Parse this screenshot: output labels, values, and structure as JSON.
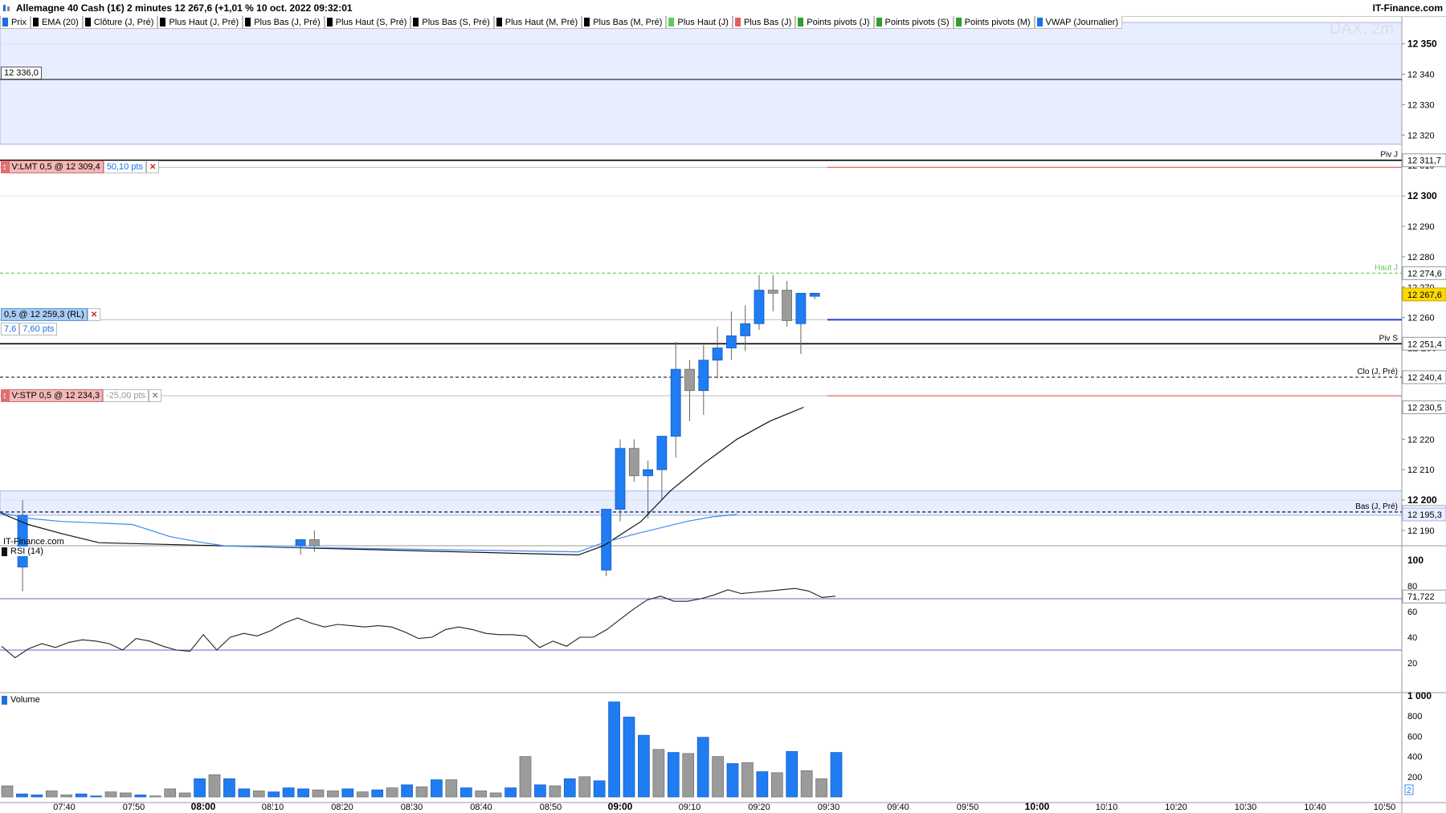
{
  "header": {
    "title": "Allemagne 40 Cash (1€) 2 minutes 12 267,6 (+1,01 % 10 oct. 2022 09:32:01",
    "brand": "IT-Finance.com"
  },
  "legend": [
    {
      "label": "Prix",
      "color": "#1f6fe0"
    },
    {
      "label": "EMA (20)",
      "color": "#000000"
    },
    {
      "label": "Clôture (J, Pré)",
      "color": "#000000"
    },
    {
      "label": "Plus Haut (J, Pré)",
      "color": "#000000"
    },
    {
      "label": "Plus Bas (J, Pré)",
      "color": "#000000"
    },
    {
      "label": "Plus Haut (S, Pré)",
      "color": "#000000"
    },
    {
      "label": "Plus Bas (S, Pré)",
      "color": "#000000"
    },
    {
      "label": "Plus Haut (M, Pré)",
      "color": "#000000"
    },
    {
      "label": "Plus Bas (M, Pré)",
      "color": "#000000"
    },
    {
      "label": "Plus Haut (J)",
      "color": "#5ecb5e"
    },
    {
      "label": "Plus Bas (J)",
      "color": "#e06060"
    },
    {
      "label": "Points pivots (J)",
      "color": "#2e9e2e"
    },
    {
      "label": "Points pivots (S)",
      "color": "#2e9e2e"
    },
    {
      "label": "Points pivots (M)",
      "color": "#2e9e2e"
    },
    {
      "label": "VWAP (Journalier)",
      "color": "#1f6fe0"
    }
  ],
  "watermark": "DAX, 2m",
  "source_label": "IT-Finance.com",
  "orders": {
    "limit": {
      "label": "V:LMT  0,5 @ 12 309,4",
      "distance": "50,10 pts",
      "price": 12309.4
    },
    "position": {
      "label": "0,5 @ 12 259,3 (RL)",
      "pnl": "7,6",
      "pnl_pts": "7,60 pts",
      "price": 12259.3
    },
    "stop": {
      "label": "V:STP  0,5 @ 12 234,3",
      "distance": "-25,00 pts",
      "price": 12234.3
    },
    "cursor_level": "12 336,0"
  },
  "levels": [
    {
      "name": "Piv J",
      "value": 12311.7,
      "label": "12 311,7",
      "color": "#000000",
      "style": "solid"
    },
    {
      "name": "Haut J",
      "value": 12274.6,
      "label": "12 274,6",
      "color": "#5ecb5e",
      "style": "dashed"
    },
    {
      "name": "Piv S",
      "value": 12251.4,
      "label": "12 251,4",
      "color": "#000000",
      "style": "solid"
    },
    {
      "name": "Clo (J, Pré)",
      "value": 12240.4,
      "label": "12 240,4",
      "color": "#000000",
      "style": "dashed"
    },
    {
      "name": "Bas (J, Pré)",
      "value": 12196.1,
      "label": "12 196,1",
      "color": "#000000",
      "style": "dashed"
    }
  ],
  "price_tags": {
    "last": {
      "value": 12267.6,
      "label": "12 267,6",
      "color": "#ffd800"
    },
    "ema": {
      "value": 12230.5,
      "label": "12 230,5"
    },
    "vwap": {
      "value": 12195.3,
      "label": "12 195,3"
    }
  },
  "price_panel": {
    "type": "candlestick",
    "ylim": [
      12185,
      12357
    ],
    "ticks": [
      {
        "v": 12350,
        "label": "12 350",
        "bold": true
      },
      {
        "v": 12340,
        "label": "12 340",
        "bold": false
      },
      {
        "v": 12330,
        "label": "12 330",
        "bold": false
      },
      {
        "v": 12320,
        "label": "12 320",
        "bold": false
      },
      {
        "v": 12310,
        "label": "12 310",
        "bold": false
      },
      {
        "v": 12300,
        "label": "12 300",
        "bold": true
      },
      {
        "v": 12290,
        "label": "12 290",
        "bold": false
      },
      {
        "v": 12280,
        "label": "12 280",
        "bold": false
      },
      {
        "v": 12270,
        "label": "12 270",
        "bold": false
      },
      {
        "v": 12260,
        "label": "12 260",
        "bold": false
      },
      {
        "v": 12250,
        "label": "12 250",
        "bold": true
      },
      {
        "v": 12240,
        "label": "12 240",
        "bold": false
      },
      {
        "v": 12230,
        "label": "12 230",
        "bold": false
      },
      {
        "v": 12220,
        "label": "12 220",
        "bold": false
      },
      {
        "v": 12210,
        "label": "12 210",
        "bold": false
      },
      {
        "v": 12200,
        "label": "12 200",
        "bold": true
      },
      {
        "v": 12190,
        "label": "12 190",
        "bold": false
      }
    ],
    "zones": [
      {
        "from": 12317,
        "to": 12357
      },
      {
        "from": 12195,
        "to": 12203
      }
    ]
  },
  "chart_data": {
    "type": "candlestick",
    "time_labels": [
      {
        "t": "07:40",
        "bold": false
      },
      {
        "t": "07:50",
        "bold": false
      },
      {
        "t": "08:00",
        "bold": true
      },
      {
        "t": "08:10",
        "bold": false
      },
      {
        "t": "08:20",
        "bold": false
      },
      {
        "t": "08:30",
        "bold": false
      },
      {
        "t": "08:40",
        "bold": false
      },
      {
        "t": "08:50",
        "bold": false
      },
      {
        "t": "09:00",
        "bold": true
      },
      {
        "t": "09:10",
        "bold": false
      },
      {
        "t": "09:20",
        "bold": false
      },
      {
        "t": "09:30",
        "bold": false
      },
      {
        "t": "09:40",
        "bold": false
      },
      {
        "t": "09:50",
        "bold": false
      },
      {
        "t": "10:00",
        "bold": true
      },
      {
        "t": "10:10",
        "bold": false
      },
      {
        "t": "10:20",
        "bold": false
      },
      {
        "t": "10:30",
        "bold": false
      },
      {
        "t": "10:40",
        "bold": false
      },
      {
        "t": "10:50",
        "bold": false
      }
    ],
    "candles": [
      {
        "t": "07:34",
        "o": 12178,
        "h": 12200,
        "l": 12170,
        "c": 12195
      },
      {
        "t": "08:14",
        "o": 12185,
        "h": 12187,
        "l": 12182,
        "c": 12187
      },
      {
        "t": "08:16",
        "o": 12187,
        "h": 12190,
        "l": 12183,
        "c": 12185
      },
      {
        "t": "08:58",
        "o": 12177,
        "h": 12197,
        "l": 12175,
        "c": 12197
      },
      {
        "t": "09:00",
        "o": 12197,
        "h": 12220,
        "l": 12193,
        "c": 12217
      },
      {
        "t": "09:02",
        "o": 12217,
        "h": 12220,
        "l": 12206,
        "c": 12208
      },
      {
        "t": "09:04",
        "o": 12208,
        "h": 12213,
        "l": 12194,
        "c": 12210
      },
      {
        "t": "09:06",
        "o": 12210,
        "h": 12215,
        "l": 12200,
        "c": 12221
      },
      {
        "t": "09:08",
        "o": 12221,
        "h": 12252,
        "l": 12214,
        "c": 12243
      },
      {
        "t": "09:10",
        "o": 12243,
        "h": 12246,
        "l": 12226,
        "c": 12236
      },
      {
        "t": "09:12",
        "o": 12236,
        "h": 12251,
        "l": 12228,
        "c": 12246
      },
      {
        "t": "09:14",
        "o": 12246,
        "h": 12257,
        "l": 12240,
        "c": 12250
      },
      {
        "t": "09:16",
        "o": 12250,
        "h": 12262,
        "l": 12246,
        "c": 12254
      },
      {
        "t": "09:18",
        "o": 12254,
        "h": 12264,
        "l": 12249,
        "c": 12258
      },
      {
        "t": "09:20",
        "o": 12258,
        "h": 12274,
        "l": 12256,
        "c": 12269
      },
      {
        "t": "09:22",
        "o": 12269,
        "h": 12274,
        "l": 12262,
        "c": 12268
      },
      {
        "t": "09:24",
        "o": 12269,
        "h": 12272,
        "l": 12257,
        "c": 12259
      },
      {
        "t": "09:26",
        "o": 12258,
        "h": 12268,
        "l": 12248,
        "c": 12268
      },
      {
        "t": "09:28",
        "o": 12267,
        "h": 12268,
        "l": 12266,
        "c": 12268
      }
    ],
    "ema": [
      [
        7.51,
        12196
      ],
      [
        7.58,
        12192
      ],
      [
        7.66,
        12189
      ],
      [
        7.75,
        12186
      ],
      [
        8.9,
        12182
      ],
      [
        8.96,
        12185
      ],
      [
        9.05,
        12193
      ],
      [
        9.12,
        12203
      ],
      [
        9.2,
        12212
      ],
      [
        9.28,
        12220
      ],
      [
        9.36,
        12226
      ],
      [
        9.44,
        12230.5
      ]
    ],
    "vwap": [
      [
        7.51,
        12196
      ],
      [
        7.58,
        12194
      ],
      [
        7.66,
        12193
      ],
      [
        7.83,
        12192
      ],
      [
        7.92,
        12188
      ],
      [
        8.0,
        12186
      ],
      [
        8.05,
        12185
      ],
      [
        8.22,
        12184.5
      ],
      [
        8.9,
        12183
      ],
      [
        8.96,
        12186
      ],
      [
        9.04,
        12189
      ],
      [
        9.1,
        12191
      ],
      [
        9.16,
        12193
      ],
      [
        9.22,
        12194.5
      ],
      [
        9.28,
        12195.3
      ]
    ],
    "rsi": {
      "label": "RSI (14)",
      "value_label": "71,722",
      "ylim": [
        0,
        110
      ],
      "ticks": [
        {
          "v": 100,
          "label": "100",
          "bold": true
        },
        {
          "v": 80,
          "label": "80",
          "bold": false
        },
        {
          "v": 60,
          "label": "60",
          "bold": false
        },
        {
          "v": 40,
          "label": "40",
          "bold": false
        },
        {
          "v": 20,
          "label": "20",
          "bold": false
        }
      ],
      "bands": [
        70,
        30
      ],
      "values": [
        33,
        24,
        31,
        35,
        32,
        36,
        38,
        37,
        35,
        30,
        39,
        37,
        33,
        30,
        29,
        42,
        30,
        40,
        43,
        41,
        45,
        51,
        55,
        51,
        48,
        50,
        49,
        48,
        49,
        48,
        44,
        39,
        40,
        46,
        48,
        46,
        43,
        42,
        42,
        41,
        32,
        37,
        33,
        40,
        40,
        46,
        54,
        62,
        69,
        72,
        68,
        68,
        70,
        73,
        77,
        74,
        75,
        76,
        77,
        78,
        76,
        71,
        72
      ]
    },
    "volume": {
      "label": "Volume",
      "ylim": [
        0,
        1050
      ],
      "ticks": [
        {
          "v": 1000,
          "label": "1 000",
          "bold": true
        },
        {
          "v": 800,
          "label": "800",
          "bold": false
        },
        {
          "v": 600,
          "label": "600",
          "bold": false
        },
        {
          "v": 400,
          "label": "400",
          "bold": false
        },
        {
          "v": 200,
          "label": "200",
          "bold": false
        }
      ],
      "current_label": "2",
      "bars": [
        {
          "v": 110,
          "d": "down"
        },
        {
          "v": 30,
          "d": "up"
        },
        {
          "v": 20,
          "d": "up"
        },
        {
          "v": 60,
          "d": "down"
        },
        {
          "v": 20,
          "d": "down"
        },
        {
          "v": 30,
          "d": "up"
        },
        {
          "v": 10,
          "d": "up"
        },
        {
          "v": 50,
          "d": "down"
        },
        {
          "v": 40,
          "d": "down"
        },
        {
          "v": 20,
          "d": "up"
        },
        {
          "v": 10,
          "d": "down"
        },
        {
          "v": 80,
          "d": "down"
        },
        {
          "v": 40,
          "d": "down"
        },
        {
          "v": 180,
          "d": "up"
        },
        {
          "v": 220,
          "d": "down"
        },
        {
          "v": 180,
          "d": "up"
        },
        {
          "v": 80,
          "d": "up"
        },
        {
          "v": 60,
          "d": "down"
        },
        {
          "v": 50,
          "d": "up"
        },
        {
          "v": 90,
          "d": "up"
        },
        {
          "v": 80,
          "d": "up"
        },
        {
          "v": 70,
          "d": "down"
        },
        {
          "v": 60,
          "d": "down"
        },
        {
          "v": 80,
          "d": "up"
        },
        {
          "v": 50,
          "d": "down"
        },
        {
          "v": 70,
          "d": "up"
        },
        {
          "v": 90,
          "d": "down"
        },
        {
          "v": 120,
          "d": "up"
        },
        {
          "v": 100,
          "d": "down"
        },
        {
          "v": 170,
          "d": "up"
        },
        {
          "v": 170,
          "d": "down"
        },
        {
          "v": 90,
          "d": "up"
        },
        {
          "v": 60,
          "d": "down"
        },
        {
          "v": 40,
          "d": "down"
        },
        {
          "v": 90,
          "d": "up"
        },
        {
          "v": 400,
          "d": "down"
        },
        {
          "v": 120,
          "d": "up"
        },
        {
          "v": 110,
          "d": "down"
        },
        {
          "v": 180,
          "d": "up"
        },
        {
          "v": 200,
          "d": "down"
        },
        {
          "v": 160,
          "d": "up"
        },
        {
          "v": 940,
          "d": "up"
        },
        {
          "v": 790,
          "d": "up"
        },
        {
          "v": 610,
          "d": "up"
        },
        {
          "v": 470,
          "d": "down"
        },
        {
          "v": 440,
          "d": "up"
        },
        {
          "v": 430,
          "d": "down"
        },
        {
          "v": 590,
          "d": "up"
        },
        {
          "v": 400,
          "d": "down"
        },
        {
          "v": 330,
          "d": "up"
        },
        {
          "v": 340,
          "d": "down"
        },
        {
          "v": 250,
          "d": "up"
        },
        {
          "v": 240,
          "d": "down"
        },
        {
          "v": 450,
          "d": "up"
        },
        {
          "v": 260,
          "d": "down"
        },
        {
          "v": 180,
          "d": "down"
        },
        {
          "v": 440,
          "d": "up"
        }
      ]
    }
  }
}
